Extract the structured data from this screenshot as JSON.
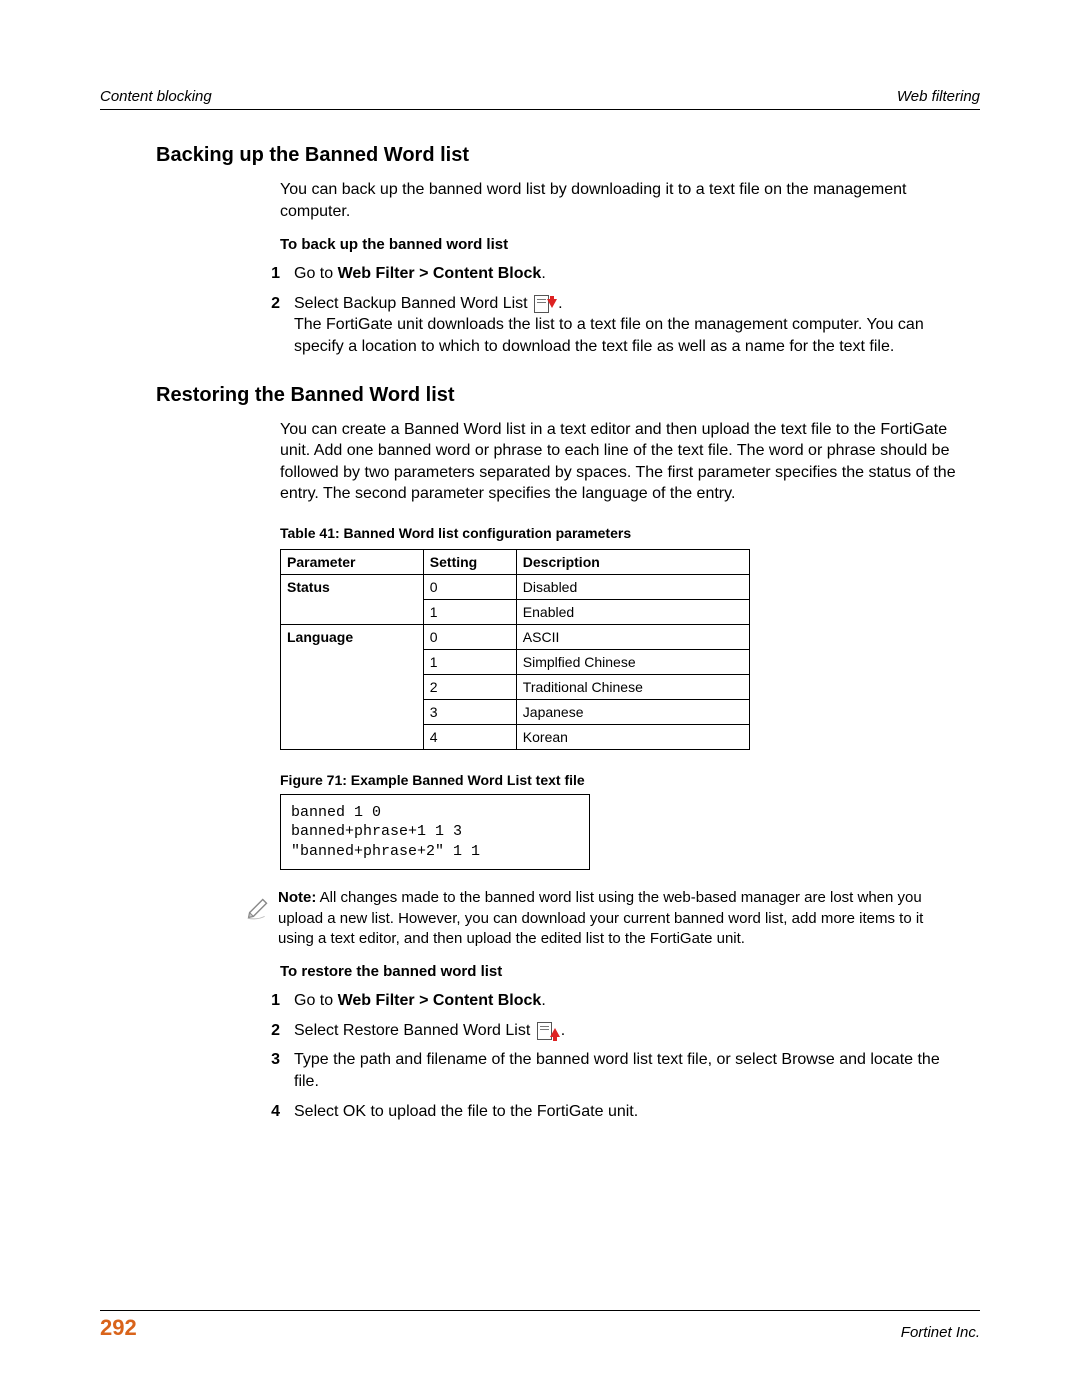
{
  "header": {
    "left": "Content blocking",
    "right": "Web filtering"
  },
  "section1": {
    "heading": "Backing up the Banned Word list",
    "intro": "You can back up the banned word list by downloading it to a text file on the management computer.",
    "proc_title": "To back up the banned word list",
    "step1_prefix": "Go to ",
    "step1_bold": "Web Filter > Content Block",
    "step1_suffix": ".",
    "step2_text": "Select Backup Banned Word List ",
    "step2_tail": ".",
    "step2_followup": "The FortiGate unit downloads the list to a text file on the management computer. You can specify a location to which to download the text file as well as a name for the text file."
  },
  "section2": {
    "heading": "Restoring the Banned Word list",
    "intro": "You can create a Banned Word list in a text editor and then upload the text file to the FortiGate unit. Add one banned word or phrase to each line of the text file. The word or phrase should be followed by two parameters separated by spaces. The first parameter specifies the status of the entry. The second parameter specifies the language of the entry."
  },
  "table": {
    "caption": "Table 41: Banned Word list configuration parameters",
    "headers": [
      "Parameter",
      "Setting",
      "Description"
    ],
    "rows": [
      {
        "param": "Status",
        "setting": "0",
        "desc": "Disabled"
      },
      {
        "param": "",
        "setting": "1",
        "desc": "Enabled"
      },
      {
        "param": "Language",
        "setting": "0",
        "desc": "ASCII"
      },
      {
        "param": "",
        "setting": "1",
        "desc": "Simplfied Chinese"
      },
      {
        "param": "",
        "setting": "2",
        "desc": "Traditional Chinese"
      },
      {
        "param": "",
        "setting": "3",
        "desc": "Japanese"
      },
      {
        "param": "",
        "setting": "4",
        "desc": "Korean"
      }
    ]
  },
  "figure": {
    "caption": "Figure 71: Example Banned Word List text file",
    "code": "banned 1 0\nbanned+phrase+1 1 3\n\"banned+phrase+2\" 1 1"
  },
  "note": {
    "label": "Note:",
    "text": " All changes made to the banned word list using the web-based manager are lost when you upload a new list. However, you can download your current banned word list, add more items to it using a text editor, and then upload the edited list to the FortiGate unit."
  },
  "restore": {
    "proc_title": "To restore the banned word list",
    "step1_prefix": "Go to ",
    "step1_bold": "Web Filter > Content Block",
    "step1_suffix": ".",
    "step2_text": "Select Restore Banned Word List ",
    "step2_tail": ".",
    "step3": "Type the path and filename of the banned word list text file, or select Browse and locate the file.",
    "step4": "Select OK to upload the file to the FortiGate unit."
  },
  "footer": {
    "page": "292",
    "right": "Fortinet Inc."
  },
  "nums": {
    "n1": "1",
    "n2": "2",
    "n3": "3",
    "n4": "4"
  }
}
